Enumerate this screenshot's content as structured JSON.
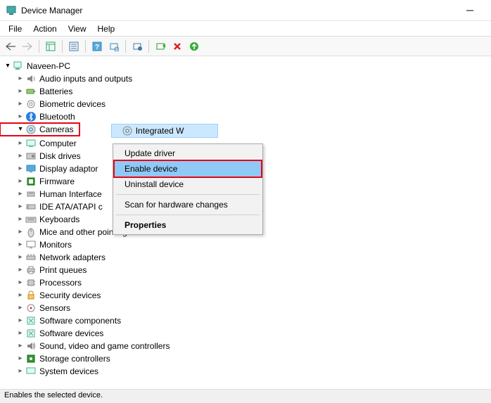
{
  "window": {
    "title": "Device Manager"
  },
  "menu": {
    "file": "File",
    "action": "Action",
    "view": "View",
    "help": "Help"
  },
  "root": {
    "name": "Naveen-PC"
  },
  "categories": [
    {
      "label": "Audio inputs and outputs",
      "icon": "audio"
    },
    {
      "label": "Batteries",
      "icon": "battery"
    },
    {
      "label": "Biometric devices",
      "icon": "biometric"
    },
    {
      "label": "Bluetooth",
      "icon": "bluetooth"
    },
    {
      "label": "Cameras",
      "icon": "camera",
      "open": true,
      "highlight": true,
      "children": [
        {
          "label": "Integrated W",
          "icon": "camera",
          "selected": true,
          "cut": true
        }
      ]
    },
    {
      "label": "Computer",
      "icon": "computer"
    },
    {
      "label": "Disk drives",
      "icon": "disk"
    },
    {
      "label": "Display adaptor",
      "icon": "display",
      "cut": true
    },
    {
      "label": "Firmware",
      "icon": "firmware"
    },
    {
      "label": "Human Interface",
      "icon": "hid",
      "cut": true
    },
    {
      "label": "IDE ATA/ATAPI c",
      "icon": "ide",
      "cut": true
    },
    {
      "label": "Keyboards",
      "icon": "keyboard"
    },
    {
      "label": "Mice and other pointing devices",
      "icon": "mouse"
    },
    {
      "label": "Monitors",
      "icon": "monitor"
    },
    {
      "label": "Network adapters",
      "icon": "network"
    },
    {
      "label": "Print queues",
      "icon": "printer"
    },
    {
      "label": "Processors",
      "icon": "cpu"
    },
    {
      "label": "Security devices",
      "icon": "security"
    },
    {
      "label": "Sensors",
      "icon": "sensor"
    },
    {
      "label": "Software components",
      "icon": "software"
    },
    {
      "label": "Software devices",
      "icon": "software"
    },
    {
      "label": "Sound, video and game controllers",
      "icon": "sound"
    },
    {
      "label": "Storage controllers",
      "icon": "storage"
    },
    {
      "label": "System devices",
      "icon": "system",
      "cutbottom": true
    }
  ],
  "context": {
    "update": "Update driver",
    "enable": "Enable device",
    "uninstall": "Uninstall device",
    "scan": "Scan for hardware changes",
    "properties": "Properties"
  },
  "status": {
    "text": "Enables the selected device."
  }
}
